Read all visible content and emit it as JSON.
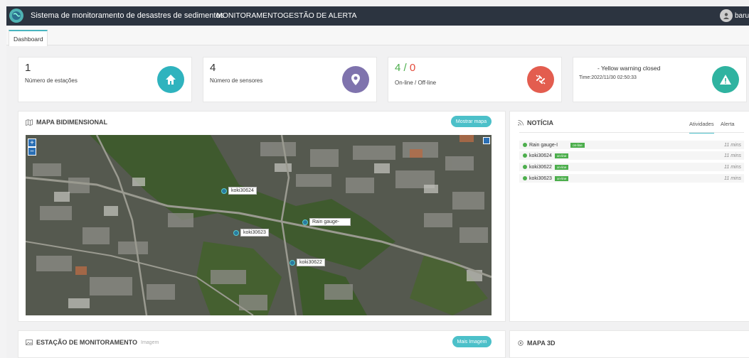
{
  "header": {
    "app_title": "Sistema de monitoramento de desastres de sedimentos",
    "nav": [
      "MONITORAMENTO",
      "GESTÃO DE ALERTA"
    ],
    "user": "barue"
  },
  "tabs": [
    "Dashboard"
  ],
  "stats": [
    {
      "value": "1",
      "label": "Número de estações",
      "icon": "home-icon",
      "color": "#2fb3be"
    },
    {
      "value": "4",
      "label": "Número de sensores",
      "icon": "location-pin-icon",
      "color": "#7f73ad"
    },
    {
      "online": "4",
      "sep": " / ",
      "offline": "0",
      "label": "On-line / Off-line",
      "icon": "broken-link-icon",
      "color": "#e35d4f"
    },
    {
      "title": "- Yellow warning closed",
      "time": "Time:2022/11/30 02:50:33",
      "icon": "warning-icon",
      "color": "#2fb3a0"
    }
  ],
  "map_panel": {
    "title": "MAPA BIDIMENSIONAL",
    "button": "Mostrar mapa",
    "zoom_in": "+",
    "zoom_out": "−",
    "markers": [
      "koki30624",
      "Rain gauge-",
      "koki30623",
      "koki30622"
    ]
  },
  "news_panel": {
    "title": "NOTÍCIA",
    "tabs": [
      "Atividades",
      "Alerta"
    ],
    "items": [
      {
        "name": "Rain gauge-I",
        "badge": "on-line",
        "time": "11 mins"
      },
      {
        "name": "koki30624",
        "badge": "on-line",
        "time": "11 mins"
      },
      {
        "name": "koki30622",
        "badge": "on-line",
        "time": "11 mins"
      },
      {
        "name": "koki30623",
        "badge": "on-line",
        "time": "11 mins"
      }
    ]
  },
  "station_panel": {
    "title": "ESTAÇÃO DE MONITORAMENTO",
    "subtitle": "Imagem",
    "button": "Mais Imagem"
  },
  "map3d_panel": {
    "title": "MAPA 3D"
  }
}
